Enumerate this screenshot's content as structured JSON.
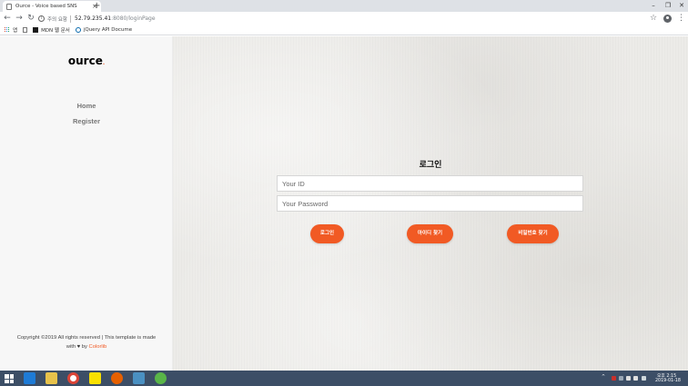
{
  "browser": {
    "tab_title": "Ource - Voice based SNS",
    "tab_close": "×",
    "new_tab": "+",
    "window_controls": {
      "minimize": "–",
      "maximize": "❐",
      "close": "✕"
    },
    "nav": {
      "back": "←",
      "forward": "→",
      "reload": "↻"
    },
    "address": {
      "info": "i",
      "security_label": "주의 요함",
      "host": "52.79.235.41",
      "path": ":8080/loginPage"
    },
    "star": "☆",
    "menu": "⋮",
    "bookmarks": [
      {
        "label": "앱"
      },
      {
        "label": "MDN 웹 문서"
      },
      {
        "label": "jQuery API Docume"
      }
    ]
  },
  "sidebar": {
    "logo": "ource",
    "logo_dot": ".",
    "nav": [
      {
        "label": "Home"
      },
      {
        "label": "Register"
      }
    ],
    "copyright_line1": "Copyright ©2019 All rights reserved | This template is made",
    "copyright_with": "with",
    "heart": "♥",
    "copyright_by": "by",
    "copyright_link": "Colorlib"
  },
  "login": {
    "title": "로그인",
    "id_placeholder": "Your ID",
    "password_placeholder": "Your Password",
    "login_button": "로그인",
    "find_id_button": "아이디 찾기",
    "find_password_button": "비밀번호 찾기"
  },
  "taskbar": {
    "time": "오후 2:15",
    "date": "2019-01-18",
    "tray_chevron": "^"
  },
  "colors": {
    "accent": "#f15a24",
    "taskbar": "#3c4e66"
  }
}
